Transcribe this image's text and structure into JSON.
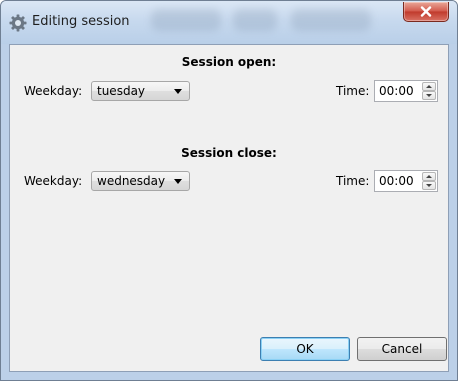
{
  "window": {
    "title": "Editing session",
    "icons": {
      "app": "gear-icon",
      "close": "close-icon"
    }
  },
  "open_section": {
    "title": "Session open:",
    "weekday_label": "Weekday:",
    "weekday_value": "tuesday",
    "time_label": "Time:",
    "time_value": "00:00"
  },
  "close_section": {
    "title": "Session close:",
    "weekday_label": "Weekday:",
    "weekday_value": "wednesday",
    "time_label": "Time:",
    "time_value": "00:00"
  },
  "buttons": {
    "ok": "OK",
    "cancel": "Cancel"
  },
  "colors": {
    "close_button": "#c0392b",
    "default_button_border": "#3c7fb1",
    "client_bg": "#f0f0f0"
  }
}
